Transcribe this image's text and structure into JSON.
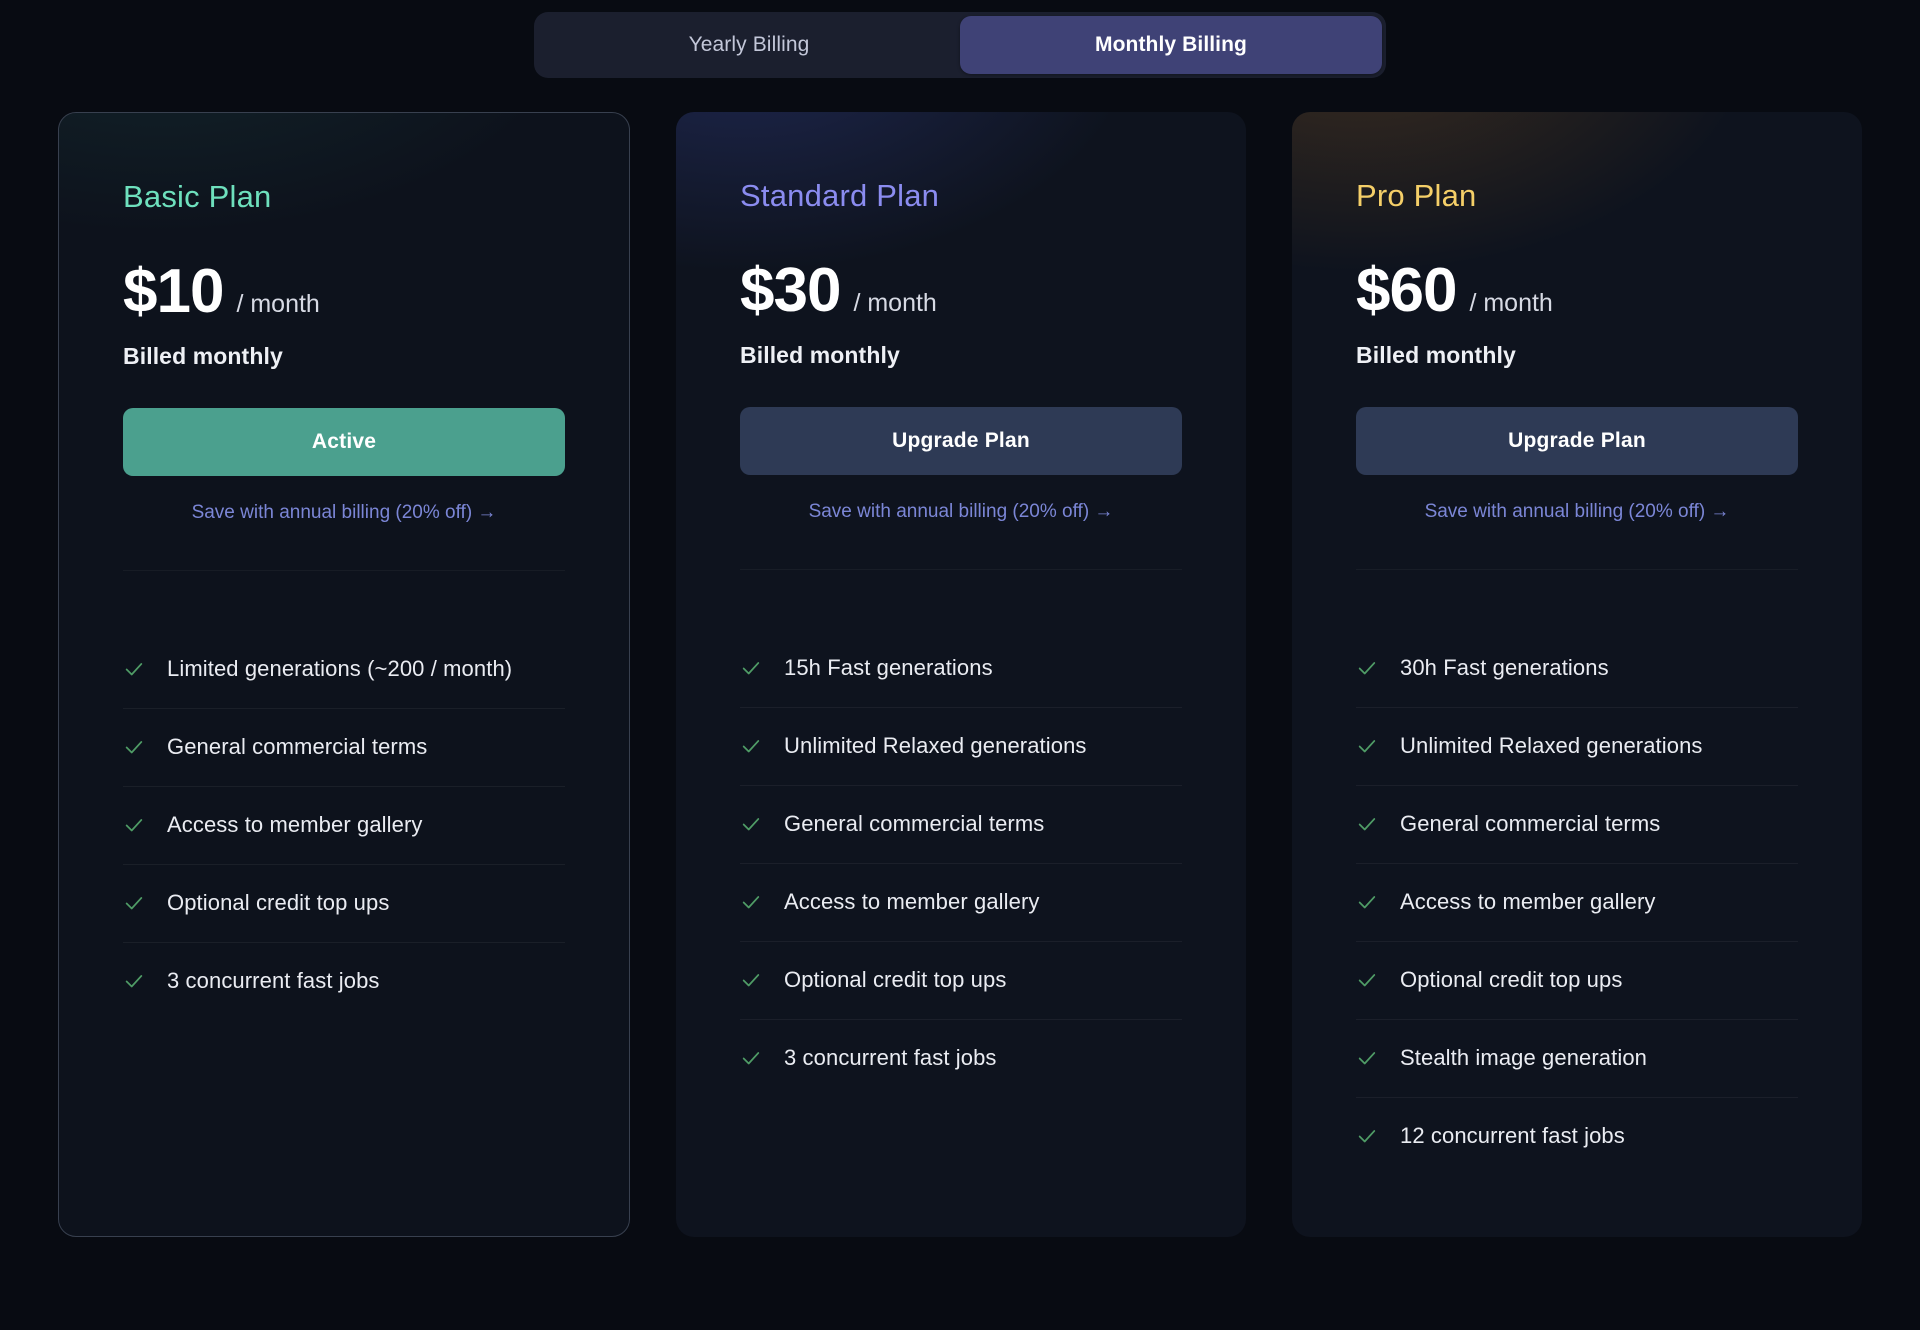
{
  "billing_toggle": {
    "yearly_label": "Yearly Billing",
    "monthly_label": "Monthly Billing",
    "selected": "Monthly Billing"
  },
  "colors": {
    "page_bg": "#080b12",
    "basic_accent": "#6ee0bd",
    "standard_accent": "#8b8cf0",
    "pro_accent": "#f5cf68",
    "active_button": "#4ba08e",
    "upgrade_button": "#2e3a55",
    "toggle_active": "#3f4276",
    "link": "#7b86d6",
    "check": "#4f9c66"
  },
  "plans": [
    {
      "name": "Basic Plan",
      "price": "$10",
      "period": "/ month",
      "billed_note": "Billed monthly",
      "cta_label": "Active",
      "cta_state": "active",
      "save_link": "Save with annual billing (20% off) →",
      "selected": true,
      "features": [
        "Limited generations (~200 / month)",
        "General commercial terms",
        "Access to member gallery",
        "Optional credit top ups",
        "3 concurrent fast jobs"
      ]
    },
    {
      "name": "Standard Plan",
      "price": "$30",
      "period": "/ month",
      "billed_note": "Billed monthly",
      "cta_label": "Upgrade Plan",
      "cta_state": "upgrade",
      "save_link": "Save with annual billing (20% off) →",
      "selected": false,
      "features": [
        "15h Fast generations",
        "Unlimited Relaxed generations",
        "General commercial terms",
        "Access to member gallery",
        "Optional credit top ups",
        "3 concurrent fast jobs"
      ]
    },
    {
      "name": "Pro Plan",
      "price": "$60",
      "period": "/ month",
      "billed_note": "Billed monthly",
      "cta_label": "Upgrade Plan",
      "cta_state": "upgrade",
      "save_link": "Save with annual billing (20% off) →",
      "selected": false,
      "features": [
        "30h Fast generations",
        "Unlimited Relaxed generations",
        "General commercial terms",
        "Access to member gallery",
        "Optional credit top ups",
        "Stealth image generation",
        "12 concurrent fast jobs"
      ]
    }
  ]
}
